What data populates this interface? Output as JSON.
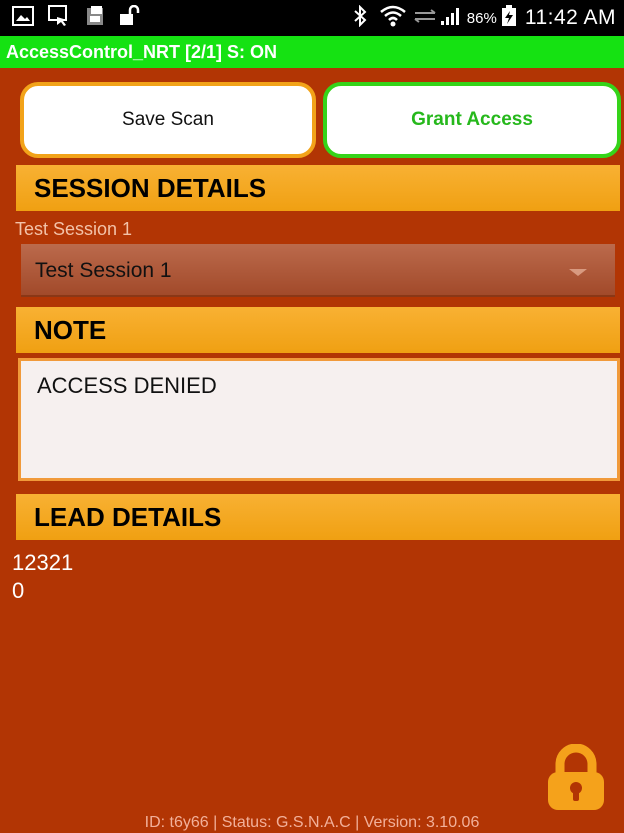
{
  "status_bar": {
    "battery": "86%",
    "time": "11:42 AM"
  },
  "app": {
    "title": "AccessControl_NRT [2/1] S: ON"
  },
  "buttons": {
    "save": "Save Scan",
    "grant": "Grant Access"
  },
  "sections": {
    "session": "SESSION DETAILS",
    "note": "NOTE",
    "lead": "LEAD DETAILS"
  },
  "session": {
    "label": "Test Session 1",
    "selected": "Test Session 1"
  },
  "note": {
    "text": "ACCESS DENIED"
  },
  "lead": {
    "line1": "12321",
    "line2": "0"
  },
  "footer": {
    "text": "ID: t6y66 | Status: G.S.N.A.C | Version: 3.10.06"
  },
  "colors": {
    "background": "#b23504",
    "title_bar": "#15e212",
    "section_header": "#f4a823",
    "grant_accent": "#26b81c",
    "save_border": "#f2a319",
    "lock": "#f5a21b"
  },
  "icons": [
    "gallery-icon",
    "screen-mirror-icon",
    "sim-icon",
    "unlock-icon",
    "bluetooth-icon",
    "wifi-icon",
    "signal-icon",
    "battery-charging-icon",
    "lock-icon",
    "dropdown-arrow-icon"
  ]
}
